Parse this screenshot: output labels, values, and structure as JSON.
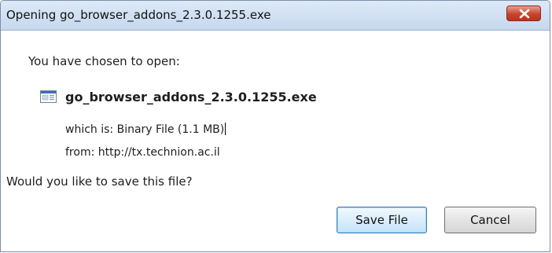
{
  "window": {
    "title": "Opening go_browser_addons_2.3.0.1255.exe"
  },
  "dialog": {
    "chosen_label": "You have chosen to open:",
    "file_name": "go_browser_addons_2.3.0.1255.exe",
    "type_label": "which is:",
    "type_value": "Binary File (1.1 MB)",
    "from_label": "from:",
    "from_value": "http://tx.technion.ac.il",
    "question": "Would you like to save this file?"
  },
  "buttons": {
    "save": "Save File",
    "cancel": "Cancel"
  },
  "icons": {
    "close": "close-icon",
    "file": "executable-file-icon"
  },
  "colors": {
    "titlebar": "#c6d8ee",
    "close_button": "#c6452f",
    "default_button_border": "#3c7fb1"
  }
}
